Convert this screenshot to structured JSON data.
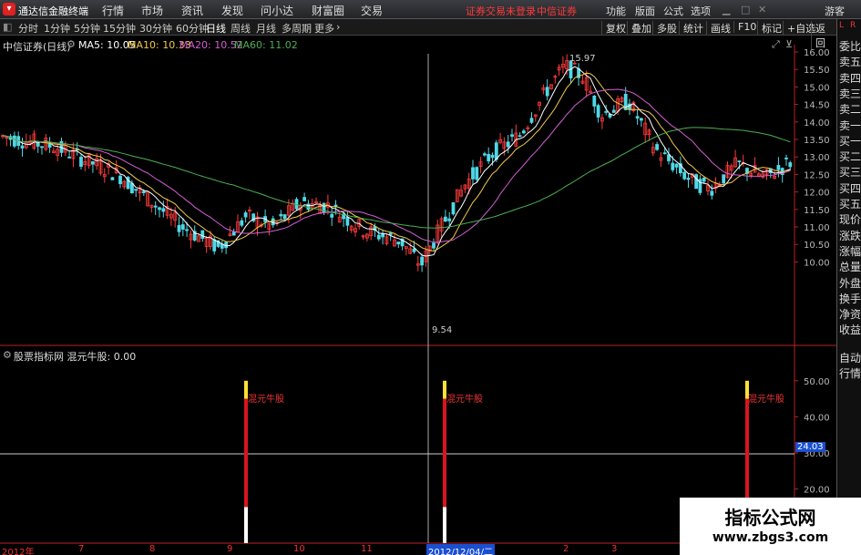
{
  "menubar": {
    "app_title": "通达信金融终端",
    "items": [
      "行情",
      "市场",
      "资讯",
      "发现",
      "问小达",
      "财富圈",
      "交易"
    ],
    "notice": "证券交易未登录",
    "broker": "中信证券",
    "right_items": [
      "功能",
      "版面",
      "公式",
      "选项"
    ],
    "user": "游客"
  },
  "toolbar": {
    "periods": [
      "分时",
      "1分钟",
      "5分钟",
      "15分钟",
      "30分钟",
      "60分钟",
      "日线",
      "周线",
      "月线",
      "多周期",
      "更多"
    ],
    "active_period": "日线",
    "right_buttons": [
      "复权",
      "叠加",
      "多股",
      "统计",
      "画线",
      "F10",
      "标记",
      "+自选",
      "返回"
    ]
  },
  "main_chart": {
    "title": "中信证券(日线)",
    "ma": [
      {
        "label": "MA5: 10.05",
        "color": "#ffffff"
      },
      {
        "label": "MA10: 10.33",
        "color": "#f2c94c"
      },
      {
        "label": "MA20: 10.52",
        "color": "#d45fd4"
      },
      {
        "label": "MA60: 11.02",
        "color": "#4caf50"
      }
    ],
    "high_label": "15.97",
    "low_label": "9.54",
    "y_ticks": [
      "16.00",
      "15.50",
      "15.00",
      "14.50",
      "14.00",
      "13.50",
      "13.00",
      "12.50",
      "12.00",
      "11.50",
      "11.00",
      "10.50",
      "10.00"
    ]
  },
  "sub_chart": {
    "title": "股票指标网 混元牛股: 0.00",
    "signal_label": "混元牛股",
    "y_ticks": [
      "50.00",
      "40.00",
      "30.00",
      "20.00"
    ],
    "cursor_value": "24.03"
  },
  "dates": [
    "2012年",
    "7",
    "8",
    "9",
    "10",
    "11",
    "2012/12/04/二",
    "2",
    "3"
  ],
  "right_panel": [
    "委比",
    "卖五",
    "卖四",
    "卖三",
    "卖二",
    "卖一",
    "买一",
    "买二",
    "买三",
    "买四",
    "买五",
    "现价",
    "涨跌",
    "涨幅",
    "总量",
    "外盘",
    "换手",
    "净资",
    "收益"
  ],
  "right_panel_bottom": [
    "自动",
    "行情"
  ],
  "watermark": {
    "line1": "指标公式网",
    "line2": "www.zbgs3.com"
  },
  "chart_data": {
    "type": "candlestick",
    "title": "中信证券(日线)",
    "ylim": [
      9.5,
      16.2
    ],
    "high": 15.97,
    "low": 9.54,
    "ma": {
      "MA5": 10.05,
      "MA10": 10.33,
      "MA20": 10.52,
      "MA60": 11.02
    },
    "signal": {
      "name": "混元牛股",
      "ylim": [
        10,
        55
      ],
      "bars": [
        50,
        50,
        50
      ],
      "cursor": 24.03
    }
  }
}
